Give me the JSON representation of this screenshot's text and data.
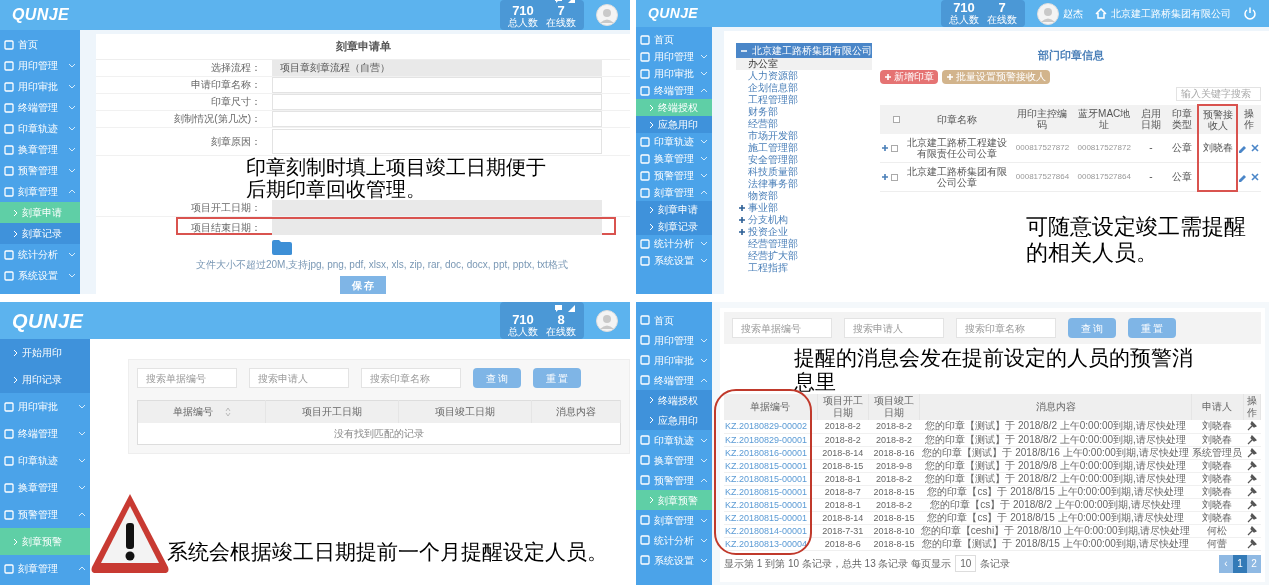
{
  "screens": [
    {
      "kind": "seal_request_form",
      "header": {
        "logo": "QUNJE",
        "stats": [
          {
            "value": "710",
            "label": "总人数"
          },
          {
            "value": "7",
            "label": "在线数"
          }
        ]
      },
      "sidebar": {
        "items": [
          {
            "label": "首页",
            "kind": "link",
            "selected": false
          },
          {
            "label": "用印管理",
            "kind": "group",
            "expanded": false,
            "selected": false
          },
          {
            "label": "用印审批",
            "kind": "group",
            "expanded": false,
            "selected": false
          },
          {
            "label": "终端管理",
            "kind": "group",
            "expanded": false,
            "selected": false
          },
          {
            "label": "印章轨迹",
            "kind": "group",
            "expanded": false,
            "selected": false
          },
          {
            "label": "换章管理",
            "kind": "group",
            "expanded": false,
            "selected": false
          },
          {
            "label": "预警管理",
            "kind": "group",
            "expanded": false,
            "selected": false
          },
          {
            "label": "刻章管理",
            "kind": "group",
            "expanded": true,
            "selected": false,
            "children": [
              {
                "label": "刻章申请",
                "selected": true
              },
              {
                "label": "刻章记录",
                "selected": false
              }
            ]
          },
          {
            "label": "统计分析",
            "kind": "group",
            "expanded": false,
            "selected": false
          },
          {
            "label": "系统设置",
            "kind": "group",
            "expanded": false,
            "selected": false
          }
        ]
      },
      "form": {
        "title": "刻章申请单",
        "fields": [
          {
            "label": "选择流程：",
            "kind": "readonly",
            "value": "项目章刻章流程（自营）",
            "highlighted": false
          },
          {
            "label": "申请印章名称：",
            "kind": "text",
            "highlighted": false
          },
          {
            "label": "印章尺寸：",
            "kind": "text",
            "highlighted": false
          },
          {
            "label": "刻制情况(第几次)：",
            "kind": "text",
            "highlighted": false
          },
          {
            "label": "刻章原因：",
            "kind": "textarea",
            "highlighted": false
          },
          {
            "label": "项目开工日期：",
            "kind": "readonly",
            "highlighted": false
          },
          {
            "label": "项目结束日期：",
            "kind": "readonly",
            "highlighted": true
          }
        ],
        "upload_hint": "文件大小不超过20M,支持jpg, png, pdf, xlsx, xls, zip, rar, doc, docx, ppt, pptx, txt格式",
        "save_button": "保 存"
      },
      "caption": "印章刻制时填上项目竣工日期便于后期印章回收管理。"
    },
    {
      "kind": "department_seals",
      "header": {
        "logo": "QUNJE",
        "stats": [
          {
            "value": "710",
            "label": "总人数"
          },
          {
            "value": "7",
            "label": "在线数"
          }
        ],
        "user": "赵杰",
        "company": "北京建工路桥集团有限公司"
      },
      "sidebar": {
        "items": [
          {
            "label": "首页",
            "kind": "link",
            "selected": false
          },
          {
            "label": "用印管理",
            "kind": "group",
            "expanded": false,
            "selected": false
          },
          {
            "label": "用印审批",
            "kind": "group",
            "expanded": false,
            "selected": false
          },
          {
            "label": "终端管理",
            "kind": "group",
            "expanded": true,
            "selected": false,
            "children": [
              {
                "label": "终端授权",
                "selected": true
              },
              {
                "label": "应急用印",
                "selected": false
              }
            ]
          },
          {
            "label": "印章轨迹",
            "kind": "group",
            "expanded": false,
            "selected": false
          },
          {
            "label": "换章管理",
            "kind": "group",
            "expanded": false,
            "selected": false
          },
          {
            "label": "预警管理",
            "kind": "group",
            "expanded": false,
            "selected": false
          },
          {
            "label": "刻章管理",
            "kind": "group",
            "expanded": true,
            "selected": false,
            "children": [
              {
                "label": "刻章申请",
                "selected": false
              },
              {
                "label": "刻章记录",
                "selected": false
              }
            ]
          },
          {
            "label": "统计分析",
            "kind": "group",
            "expanded": false,
            "selected": false
          },
          {
            "label": "系统设置",
            "kind": "group",
            "expanded": false,
            "selected": false
          }
        ]
      },
      "tree": {
        "label": "北京建工路桥集团有限公司",
        "expanded": true,
        "children": [
          {
            "label": "办公室",
            "selected": true
          },
          {
            "label": "人力资源部",
            "selected": false
          },
          {
            "label": "企划信息部",
            "selected": false
          },
          {
            "label": "工程管理部",
            "selected": false
          },
          {
            "label": "财务部",
            "selected": false
          },
          {
            "label": "经营部",
            "selected": false
          },
          {
            "label": "市场开发部",
            "selected": false
          },
          {
            "label": "施工管理部",
            "selected": false
          },
          {
            "label": "安全管理部",
            "selected": false
          },
          {
            "label": "科技质量部",
            "selected": false
          },
          {
            "label": "法律事务部",
            "selected": false
          },
          {
            "label": "物资部",
            "selected": false
          },
          {
            "label": "事业部",
            "selected": false,
            "expanded": false
          },
          {
            "label": "分支机构",
            "selected": false,
            "expanded": false
          },
          {
            "label": "投资企业",
            "selected": false,
            "expanded": false
          },
          {
            "label": "经营管理部",
            "selected": false
          },
          {
            "label": "经营扩大部",
            "selected": false
          },
          {
            "label": "工程指挥",
            "selected": false
          }
        ]
      },
      "title": "部门印章信息",
      "buttons": [
        {
          "label": "新增印章",
          "kind": "danger"
        },
        {
          "label": "批量设置预警接收人",
          "kind": "warning"
        }
      ],
      "search": {
        "placeholder": "输入关键字搜索"
      },
      "table": {
        "header_checked": false,
        "columns": [
          {
            "label": "印章名称",
            "highlighted": false
          },
          {
            "label": "用印主控编码",
            "highlighted": false
          },
          {
            "label": "蓝牙MAC地址",
            "highlighted": false
          },
          {
            "label": "启用日期",
            "highlighted": false
          },
          {
            "label": "印章类型",
            "highlighted": false
          },
          {
            "label": "预警接收人",
            "highlighted": true
          },
          {
            "label": "操作",
            "highlighted": false
          }
        ],
        "rows": [
          {
            "checked": false,
            "name": "北京建工路桥工程建设有限责任公司公章",
            "control_code": "000817527872",
            "mac": "000817527872",
            "enabled_date": "-",
            "seal_type": "公章",
            "receiver": "刘晓春"
          },
          {
            "checked": false,
            "name": "北京建工路桥集团有限公司公章",
            "control_code": "000817527864",
            "mac": "000817527864",
            "enabled_date": "-",
            "seal_type": "公章"
          }
        ]
      },
      "caption": "可随意设定竣工需提醒的相关人员。"
    },
    {
      "kind": "warning_list_empty",
      "header": {
        "logo": "QUNJE",
        "stats": [
          {
            "value": "710",
            "label": "总人数"
          },
          {
            "value": "8",
            "label": "在线数"
          }
        ]
      },
      "sidebar": {
        "items": [
          {
            "label": "开始用印",
            "kind": "subitem",
            "selected": false
          },
          {
            "label": "用印记录",
            "kind": "subitem",
            "selected": false
          },
          {
            "label": "用印审批",
            "kind": "group",
            "expanded": false,
            "selected": false
          },
          {
            "label": "终端管理",
            "kind": "group",
            "expanded": false,
            "selected": false
          },
          {
            "label": "印章轨迹",
            "kind": "group",
            "expanded": false,
            "selected": false
          },
          {
            "label": "换章管理",
            "kind": "group",
            "expanded": false,
            "selected": false
          },
          {
            "label": "预警管理",
            "kind": "group",
            "expanded": true,
            "selected": false,
            "children": [
              {
                "label": "刻章预警",
                "selected": true
              }
            ]
          },
          {
            "label": "刻章管理",
            "kind": "group",
            "expanded": true,
            "selected": false
          }
        ]
      },
      "search": {
        "placeholders": [
          "搜索单据编号",
          "搜索申请人",
          "搜索印章名称"
        ],
        "buttons": [
          "查 询",
          "重 置"
        ]
      },
      "table": {
        "columns": [
          {
            "label": "单据编号",
            "sortable": true
          },
          {
            "label": "项目开工日期",
            "sortable": false
          },
          {
            "label": "项目竣工日期",
            "sortable": false
          },
          {
            "label": "消息内容",
            "sortable": false
          }
        ],
        "empty_message": "没有找到匹配的记录"
      },
      "caption": "系统会根据竣工日期提前一个月提醒设定人员。"
    },
    {
      "kind": "warning_list",
      "sidebar": {
        "items": [
          {
            "label": "首页",
            "kind": "link",
            "selected": false
          },
          {
            "label": "用印管理",
            "kind": "group",
            "expanded": false,
            "selected": false
          },
          {
            "label": "用印审批",
            "kind": "group",
            "expanded": false,
            "selected": false
          },
          {
            "label": "终端管理",
            "kind": "group",
            "expanded": true,
            "selected": false,
            "children": [
              {
                "label": "终端授权",
                "selected": false
              },
              {
                "label": "应急用印",
                "selected": false
              }
            ]
          },
          {
            "label": "印章轨迹",
            "kind": "group",
            "expanded": false,
            "selected": false
          },
          {
            "label": "换章管理",
            "kind": "group",
            "expanded": false,
            "selected": false
          },
          {
            "label": "预警管理",
            "kind": "group",
            "expanded": true,
            "selected": false,
            "children": [
              {
                "label": "刻章预警",
                "selected": true
              }
            ]
          },
          {
            "label": "刻章管理",
            "kind": "group",
            "expanded": false,
            "selected": false
          },
          {
            "label": "统计分析",
            "kind": "group",
            "expanded": false,
            "selected": false
          },
          {
            "label": "系统设置",
            "kind": "group",
            "expanded": false,
            "selected": false
          }
        ]
      },
      "search": {
        "placeholders": [
          "搜索单据编号",
          "搜索申请人",
          "搜索印章名称"
        ],
        "buttons": [
          "查 询",
          "重 置"
        ]
      },
      "caption": "提醒的消息会发在提前设定的人员的预警消息里",
      "table": {
        "columns": [
          "单据编号",
          "项目开工日期",
          "项目竣工日期",
          "消息内容",
          "申请人",
          "操作"
        ],
        "rows": [
          {
            "number": "KZ.20180829-00002",
            "start": "2018-8-2",
            "end": "2018-8-2",
            "message": "您的印章【测试】于 2018/8/2 上午0:00:00到期,请尽快处理",
            "applicant": "刘晓春"
          },
          {
            "number": "KZ.20180829-00001",
            "start": "2018-8-2",
            "end": "2018-8-2",
            "message": "您的印章【测试】于 2018/8/2 上午0:00:00到期,请尽快处理",
            "applicant": "刘晓春"
          },
          {
            "number": "KZ.20180816-00001",
            "start": "2018-8-14",
            "end": "2018-8-16",
            "message": "您的印章【测试】于 2018/8/16 上午0:00:00到期,请尽快处理",
            "applicant": "系统管理员"
          },
          {
            "number": "KZ.20180815-00001",
            "start": "2018-8-15",
            "end": "2018-9-8",
            "message": "您的印章【测试】于 2018/9/8 上午0:00:00到期,请尽快处理",
            "applicant": "刘晓春"
          },
          {
            "number": "KZ.20180815-00001",
            "start": "2018-8-1",
            "end": "2018-8-2",
            "message": "您的印章【测试】于 2018/8/2 上午0:00:00到期,请尽快处理",
            "applicant": "刘晓春"
          },
          {
            "number": "KZ.20180815-00001",
            "start": "2018-8-7",
            "end": "2018-8-15",
            "message": "您的印章【cs】于 2018/8/15 上午0:00:00到期,请尽快处理",
            "applicant": "刘晓春"
          },
          {
            "number": "KZ.20180815-00001",
            "start": "2018-8-1",
            "end": "2018-8-2",
            "message": "您的印章【cs】于 2018/8/2 上午0:00:00到期,请尽快处理",
            "applicant": "刘晓春"
          },
          {
            "number": "KZ.20180815-00001",
            "start": "2018-8-14",
            "end": "2018-8-15",
            "message": "您的印章【cs】于 2018/8/15 上午0:00:00到期,请尽快处理",
            "applicant": "刘晓春"
          },
          {
            "number": "KZ.20180814-00001",
            "start": "2018-7-31",
            "end": "2018-8-10",
            "message": "您的印章【ceshi】于 2018/8/10 上午0:00:00到期,请尽快处理",
            "applicant": "何松"
          },
          {
            "number": "KZ.20180813-00004",
            "start": "2018-8-6",
            "end": "2018-8-15",
            "message": "您的印章【测试】于 2018/8/15 上午0:00:00到期,请尽快处理",
            "applicant": "何蕾"
          }
        ]
      },
      "footer": {
        "summary": "显示第 1 到第 10 条记录，总共 13 条记录 每页显示",
        "page_size": "10",
        "suffix": "条记录"
      },
      "pagination": [
        {
          "label": "‹",
          "selected": false
        },
        {
          "label": "1",
          "selected": true
        },
        {
          "label": "2",
          "selected": false
        }
      ]
    }
  ]
}
